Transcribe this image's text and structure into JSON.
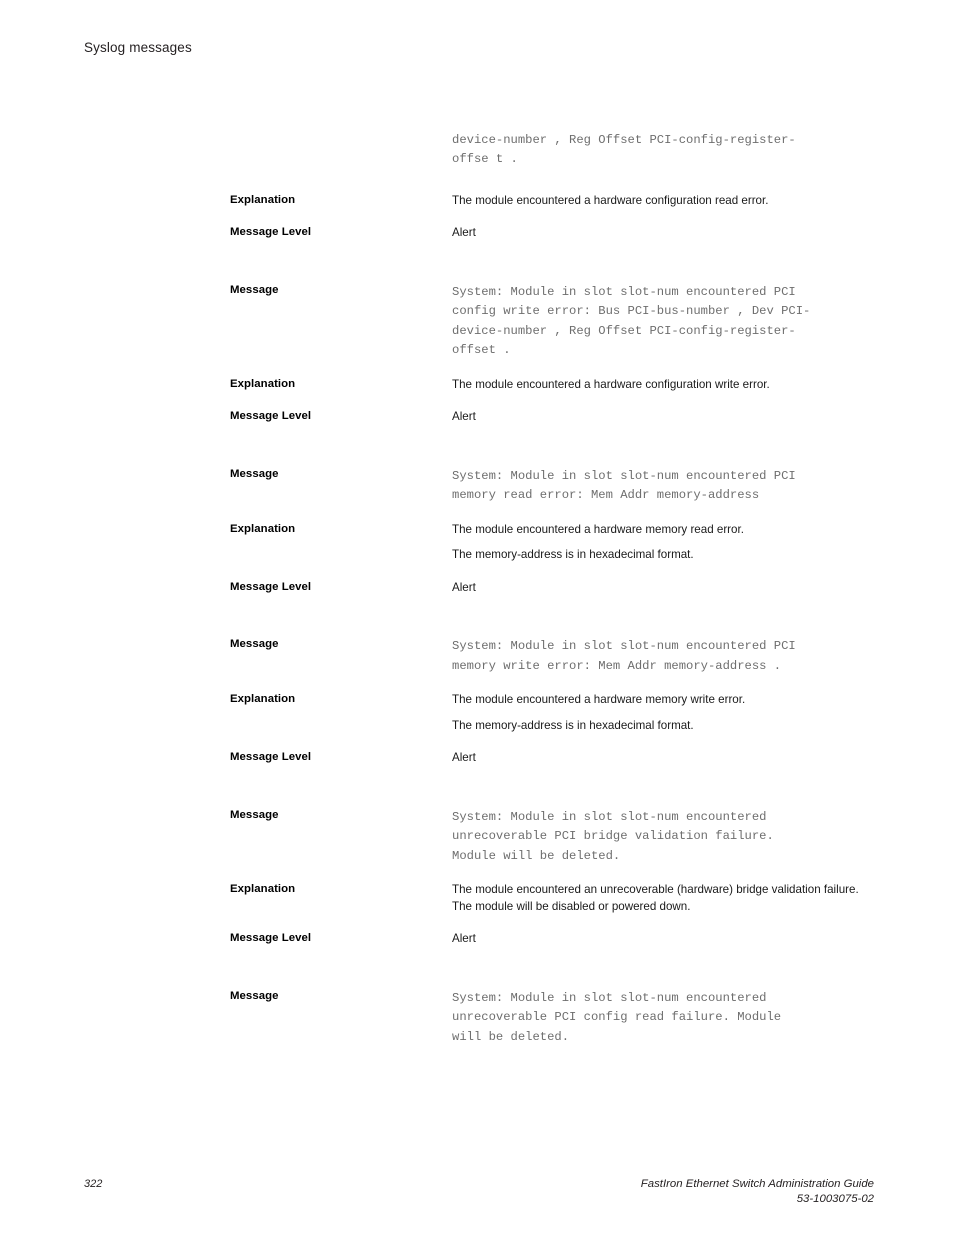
{
  "header": {
    "running_head": "Syslog messages"
  },
  "footer": {
    "page_number": "322",
    "guide_title": "FastIron Ethernet Switch Administration Guide",
    "doc_number": "53-1003075-02"
  },
  "labels": {
    "message": "Message",
    "explanation": "Explanation",
    "message_level": "Message Level"
  },
  "entries": [
    {
      "message_continuation": "device-number , Reg Offset PCI-config-register-\noffse t .",
      "explanation": [
        "The module encountered a hardware configuration read error."
      ],
      "message_level": "Alert"
    },
    {
      "message": "System: Module in slot slot-num encountered PCI\nconfig write error: Bus PCI-bus-number , Dev PCI-\ndevice-number , Reg Offset PCI-config-register-\noffset .",
      "explanation": [
        "The module encountered a hardware configuration write error."
      ],
      "message_level": "Alert"
    },
    {
      "message": "System: Module in slot slot-num encountered PCI\nmemory read error: Mem Addr memory-address",
      "explanation": [
        "The module encountered a hardware memory read error.",
        "The memory-address is in hexadecimal format."
      ],
      "message_level": "Alert"
    },
    {
      "message": "System: Module in slot slot-num encountered PCI\nmemory write error: Mem Addr memory-address .",
      "explanation": [
        "The module encountered a hardware memory write error.",
        "The memory-address is in hexadecimal format."
      ],
      "message_level": "Alert"
    },
    {
      "message": "System: Module in slot slot-num encountered\nunrecoverable PCI bridge validation failure.\nModule will be deleted.",
      "explanation": [
        "The module encountered an unrecoverable (hardware) bridge validation failure. The module will be disabled or powered down."
      ],
      "message_level": "Alert"
    },
    {
      "message": "System: Module in slot slot-num encountered\nunrecoverable PCI config read failure. Module\nwill be deleted."
    }
  ]
}
